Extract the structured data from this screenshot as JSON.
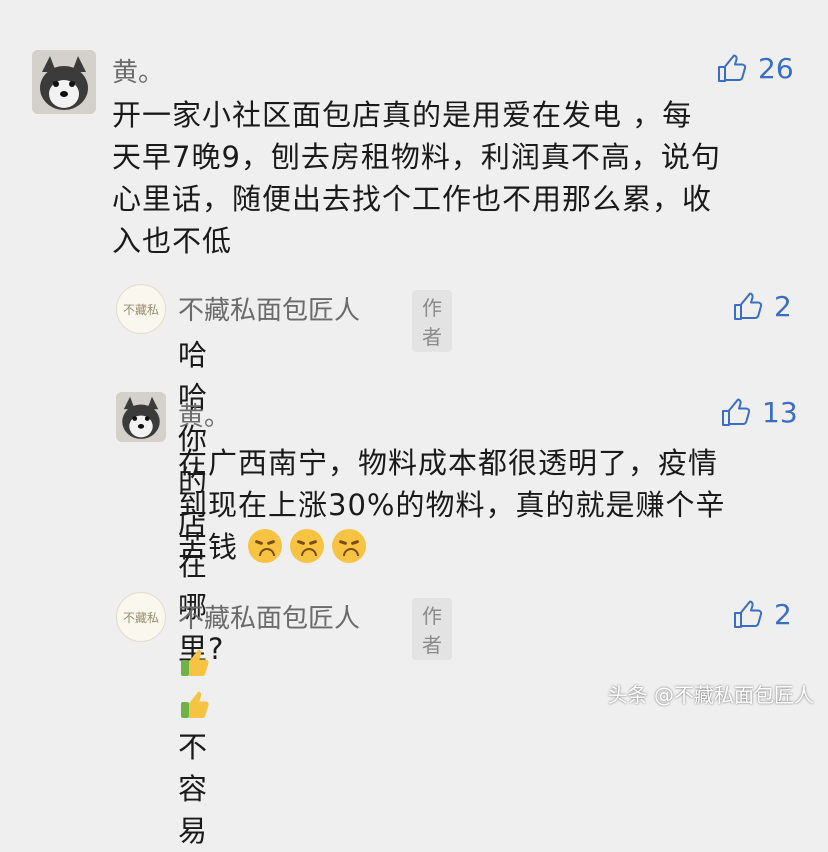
{
  "comments": [
    {
      "name": "黄。",
      "likes": "26",
      "lines": [
        "开一家小社区面包店真的是用爱在发电 ，每",
        "天早7晚9，刨去房租物料，利润真不高，说句",
        "心里话，随便出去找个工作也不用那么累，收",
        "入也不低"
      ]
    },
    {
      "name": "不藏私面包匠人",
      "tag": "作者",
      "likes": "2",
      "avatar_text": "不藏私",
      "lines": [
        "哈哈你的店在哪里?"
      ]
    },
    {
      "name": "黄。",
      "likes": "13",
      "lines": [
        "在广西南宁，物料成本都很透明了，疫情",
        "到现在上涨30%的物料，真的就是赚个辛",
        "苦钱"
      ]
    },
    {
      "name": "不藏私面包匠人",
      "tag": "作者",
      "likes": "2",
      "avatar_text": "不藏私",
      "text": "不容易"
    }
  ],
  "watermark": "头条 @不藏私面包匠人",
  "colors": {
    "like": "#3a6dc6",
    "name": "#6b6b6b",
    "background": "#efefef"
  },
  "icons": [
    "thumbs-up-outline-icon",
    "weary-face-emoji",
    "thumbs-up-emoji"
  ]
}
